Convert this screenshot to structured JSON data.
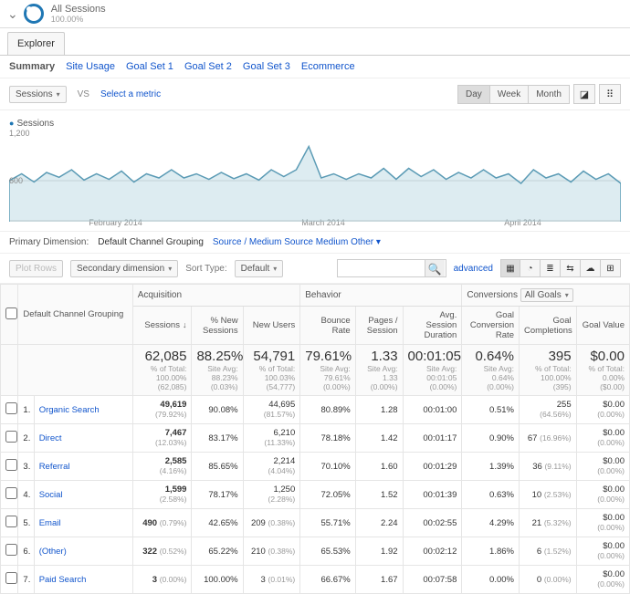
{
  "segment": {
    "title": "All Sessions",
    "sub": "100.00%"
  },
  "explorer": {
    "tab": "Explorer"
  },
  "subtabs": [
    "Summary",
    "Site Usage",
    "Goal Set 1",
    "Goal Set 2",
    "Goal Set 3",
    "Ecommerce"
  ],
  "active_subtab": 0,
  "metric_dropdown": "Sessions",
  "vs_label": "VS",
  "select_metric": "Select a metric",
  "period_buttons": [
    "Day",
    "Week",
    "Month"
  ],
  "active_period": 0,
  "chart_title": "Sessions",
  "y_max": "1,200",
  "y_mid": "600",
  "x_labels": [
    "February 2014",
    "March 2014",
    "April 2014"
  ],
  "primary_dimension": {
    "label": "Primary Dimension:",
    "value": "Default Channel Grouping",
    "links": [
      "Source / Medium",
      "Source",
      "Medium",
      "Other"
    ]
  },
  "plot_rows": "Plot Rows",
  "secondary_dim": "Secondary dimension",
  "sort_type_label": "Sort Type:",
  "sort_type_value": "Default",
  "advanced": "advanced",
  "groups": [
    "Acquisition",
    "Behavior",
    "Conversions"
  ],
  "goal_dd": "All Goals",
  "dim_col": "Default Channel Grouping",
  "cols": [
    "Sessions",
    "% New Sessions",
    "New Users",
    "Bounce Rate",
    "Pages / Session",
    "Avg. Session Duration",
    "Goal Conversion Rate",
    "Goal Completions",
    "Goal Value"
  ],
  "totals": {
    "sessions": {
      "v": "62,085",
      "s": "% of Total: 100.00% (62,085)"
    },
    "pnew": {
      "v": "88.25%",
      "s": "Site Avg: 88.23% (0.03%)"
    },
    "newu": {
      "v": "54,791",
      "s": "% of Total: 100.03% (54,777)"
    },
    "bounce": {
      "v": "79.61%",
      "s": "Site Avg: 79.61% (0.00%)"
    },
    "pages": {
      "v": "1.33",
      "s": "Site Avg: 1.33 (0.00%)"
    },
    "dur": {
      "v": "00:01:05",
      "s": "Site Avg: 00:01:05 (0.00%)"
    },
    "gcr": {
      "v": "0.64%",
      "s": "Site Avg: 0.64% (0.00%)"
    },
    "gc": {
      "v": "395",
      "s": "% of Total: 100.00% (395)"
    },
    "gv": {
      "v": "$0.00",
      "s": "% of Total: 0.00% ($0.00)"
    }
  },
  "rows": [
    {
      "n": "1.",
      "ch": "Organic Search",
      "s": "49,619",
      "sp": "(79.92%)",
      "pn": "90.08%",
      "nu": "44,695",
      "nup": "(81.57%)",
      "b": "80.89%",
      "pg": "1.28",
      "d": "00:01:00",
      "cr": "0.51%",
      "gc": "255",
      "gcp": "(64.56%)",
      "gv": "$0.00",
      "gvp": "(0.00%)"
    },
    {
      "n": "2.",
      "ch": "Direct",
      "s": "7,467",
      "sp": "(12.03%)",
      "pn": "83.17%",
      "nu": "6,210",
      "nup": "(11.33%)",
      "b": "78.18%",
      "pg": "1.42",
      "d": "00:01:17",
      "cr": "0.90%",
      "gc": "67",
      "gcp": "(16.96%)",
      "gv": "$0.00",
      "gvp": "(0.00%)"
    },
    {
      "n": "3.",
      "ch": "Referral",
      "s": "2,585",
      "sp": "(4.16%)",
      "pn": "85.65%",
      "nu": "2,214",
      "nup": "(4.04%)",
      "b": "70.10%",
      "pg": "1.60",
      "d": "00:01:29",
      "cr": "1.39%",
      "gc": "36",
      "gcp": "(9.11%)",
      "gv": "$0.00",
      "gvp": "(0.00%)"
    },
    {
      "n": "4.",
      "ch": "Social",
      "s": "1,599",
      "sp": "(2.58%)",
      "pn": "78.17%",
      "nu": "1,250",
      "nup": "(2.28%)",
      "b": "72.05%",
      "pg": "1.52",
      "d": "00:01:39",
      "cr": "0.63%",
      "gc": "10",
      "gcp": "(2.53%)",
      "gv": "$0.00",
      "gvp": "(0.00%)"
    },
    {
      "n": "5.",
      "ch": "Email",
      "s": "490",
      "sp": "(0.79%)",
      "pn": "42.65%",
      "nu": "209",
      "nup": "(0.38%)",
      "b": "55.71%",
      "pg": "2.24",
      "d": "00:02:55",
      "cr": "4.29%",
      "gc": "21",
      "gcp": "(5.32%)",
      "gv": "$0.00",
      "gvp": "(0.00%)"
    },
    {
      "n": "6.",
      "ch": "(Other)",
      "s": "322",
      "sp": "(0.52%)",
      "pn": "65.22%",
      "nu": "210",
      "nup": "(0.38%)",
      "b": "65.53%",
      "pg": "1.92",
      "d": "00:02:12",
      "cr": "1.86%",
      "gc": "6",
      "gcp": "(1.52%)",
      "gv": "$0.00",
      "gvp": "(0.00%)"
    },
    {
      "n": "7.",
      "ch": "Paid Search",
      "s": "3",
      "sp": "(0.00%)",
      "pn": "100.00%",
      "nu": "3",
      "nup": "(0.01%)",
      "b": "66.67%",
      "pg": "1.67",
      "d": "00:07:58",
      "cr": "0.00%",
      "gc": "0",
      "gcp": "(0.00%)",
      "gv": "$0.00",
      "gvp": "(0.00%)"
    }
  ],
  "chart_data": {
    "type": "line",
    "title": "Sessions",
    "ylabel": "Sessions",
    "ylim": [
      0,
      1200
    ],
    "x_range": "Feb 2014 – Apr 2014",
    "values": [
      600,
      700,
      580,
      720,
      650,
      760,
      610,
      700,
      620,
      740,
      580,
      700,
      640,
      760,
      640,
      700,
      620,
      720,
      630,
      700,
      610,
      760,
      660,
      760,
      1100,
      640,
      700,
      620,
      700,
      640,
      780,
      620,
      780,
      660,
      760,
      620,
      720,
      640,
      760,
      640,
      700,
      560,
      760,
      640,
      700,
      580,
      740,
      620,
      700,
      560
    ]
  }
}
